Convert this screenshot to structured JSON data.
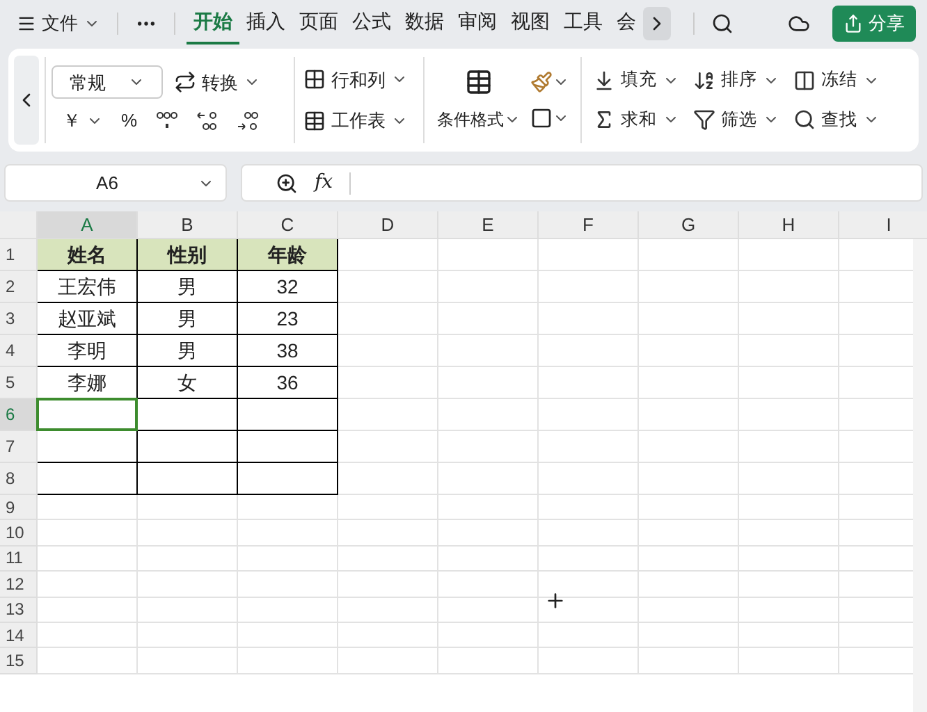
{
  "menu": {
    "label": "文件"
  },
  "tabs": [
    {
      "label": "开始",
      "selected": true
    },
    {
      "label": "插入",
      "selected": false
    },
    {
      "label": "页面",
      "selected": false
    },
    {
      "label": "公式",
      "selected": false
    },
    {
      "label": "数据",
      "selected": false
    },
    {
      "label": "审阅",
      "selected": false
    },
    {
      "label": "视图",
      "selected": false
    },
    {
      "label": "工具",
      "selected": false
    },
    {
      "label": "会",
      "selected": false
    }
  ],
  "share_button": {
    "label": "分享"
  },
  "ribbon": {
    "number_format": "常规",
    "convert": "转换",
    "currency": "￥",
    "percent": "%",
    "row_col": "行和列",
    "worksheet": "工作表",
    "conditional_format": "条件格式",
    "tools": [
      {
        "kind": "fill",
        "label": "填充"
      },
      {
        "kind": "sort",
        "label": "排序"
      },
      {
        "kind": "freeze",
        "label": "冻结"
      },
      {
        "kind": "sum",
        "label": "求和"
      },
      {
        "kind": "filter",
        "label": "筛选"
      },
      {
        "kind": "find",
        "label": "查找"
      }
    ]
  },
  "formula_bar": {
    "name_box": "A6",
    "fx": "fx"
  },
  "columns": [
    {
      "label": "A",
      "selected": true
    },
    {
      "label": "B",
      "selected": false
    },
    {
      "label": "C",
      "selected": false
    },
    {
      "label": "D",
      "selected": false
    },
    {
      "label": "E",
      "selected": false
    },
    {
      "label": "F",
      "selected": false
    },
    {
      "label": "G",
      "selected": false
    },
    {
      "label": "H",
      "selected": false
    },
    {
      "label": "I",
      "selected": false
    }
  ],
  "rows": [
    {
      "label": "1",
      "selected": false,
      "header": true,
      "cells": [
        "姓名",
        "性别",
        "年龄"
      ]
    },
    {
      "label": "2",
      "selected": false,
      "header": false,
      "cells": [
        "王宏伟",
        "男",
        "32"
      ]
    },
    {
      "label": "3",
      "selected": false,
      "header": false,
      "cells": [
        "赵亚斌",
        "男",
        "23"
      ]
    },
    {
      "label": "4",
      "selected": false,
      "header": false,
      "cells": [
        "李明",
        "男",
        "38"
      ]
    },
    {
      "label": "5",
      "selected": false,
      "header": false,
      "cells": [
        "李娜",
        "女",
        "36"
      ]
    },
    {
      "label": "6",
      "selected": true,
      "header": false,
      "cells": []
    },
    {
      "label": "7",
      "selected": false,
      "header": false,
      "cells": []
    },
    {
      "label": "8",
      "selected": false,
      "header": false,
      "cells": []
    },
    {
      "label": "9",
      "selected": false,
      "cells": []
    },
    {
      "label": "10",
      "selected": false,
      "cells": []
    },
    {
      "label": "11",
      "selected": false,
      "cells": []
    },
    {
      "label": "12",
      "selected": false,
      "cells": []
    },
    {
      "label": "13",
      "selected": false,
      "cells": []
    },
    {
      "label": "14",
      "selected": false,
      "cells": []
    },
    {
      "label": "15",
      "selected": false,
      "cells": []
    }
  ]
}
